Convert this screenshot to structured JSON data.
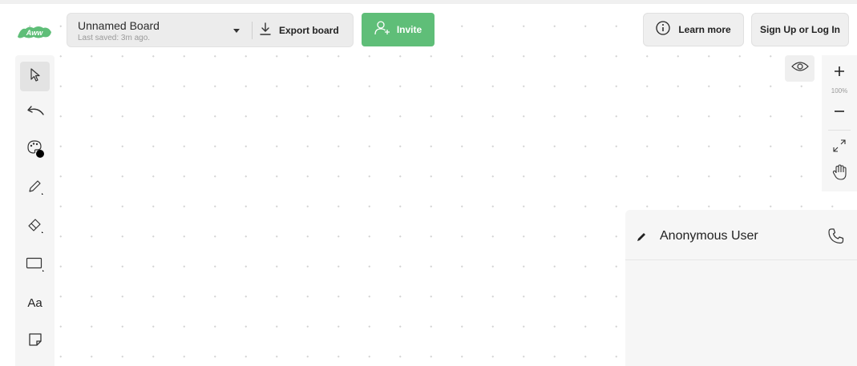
{
  "app": {
    "logo_text": "Aww",
    "brand_color": "#5fbe78"
  },
  "board": {
    "name": "Unnamed Board",
    "last_saved": "Last saved: 3m ago.",
    "export_label": "Export board"
  },
  "header": {
    "invite_label": "Invite",
    "learn_more_label": "Learn more",
    "signup_label": "Sign Up or Log In"
  },
  "toolbar": {
    "tools": [
      {
        "name": "select",
        "icon": "cursor-icon",
        "active": true
      },
      {
        "name": "undo",
        "icon": "undo-icon"
      },
      {
        "name": "color",
        "icon": "palette-icon",
        "color": "#000000"
      },
      {
        "name": "pencil",
        "icon": "pencil-icon"
      },
      {
        "name": "eraser",
        "icon": "eraser-icon"
      },
      {
        "name": "shape",
        "icon": "rectangle-icon"
      },
      {
        "name": "text",
        "label": "Aa"
      },
      {
        "name": "sticky-note",
        "icon": "sticky-note-icon"
      }
    ]
  },
  "zoom": {
    "level": "100%"
  },
  "panel": {
    "user_name": "Anonymous User"
  }
}
